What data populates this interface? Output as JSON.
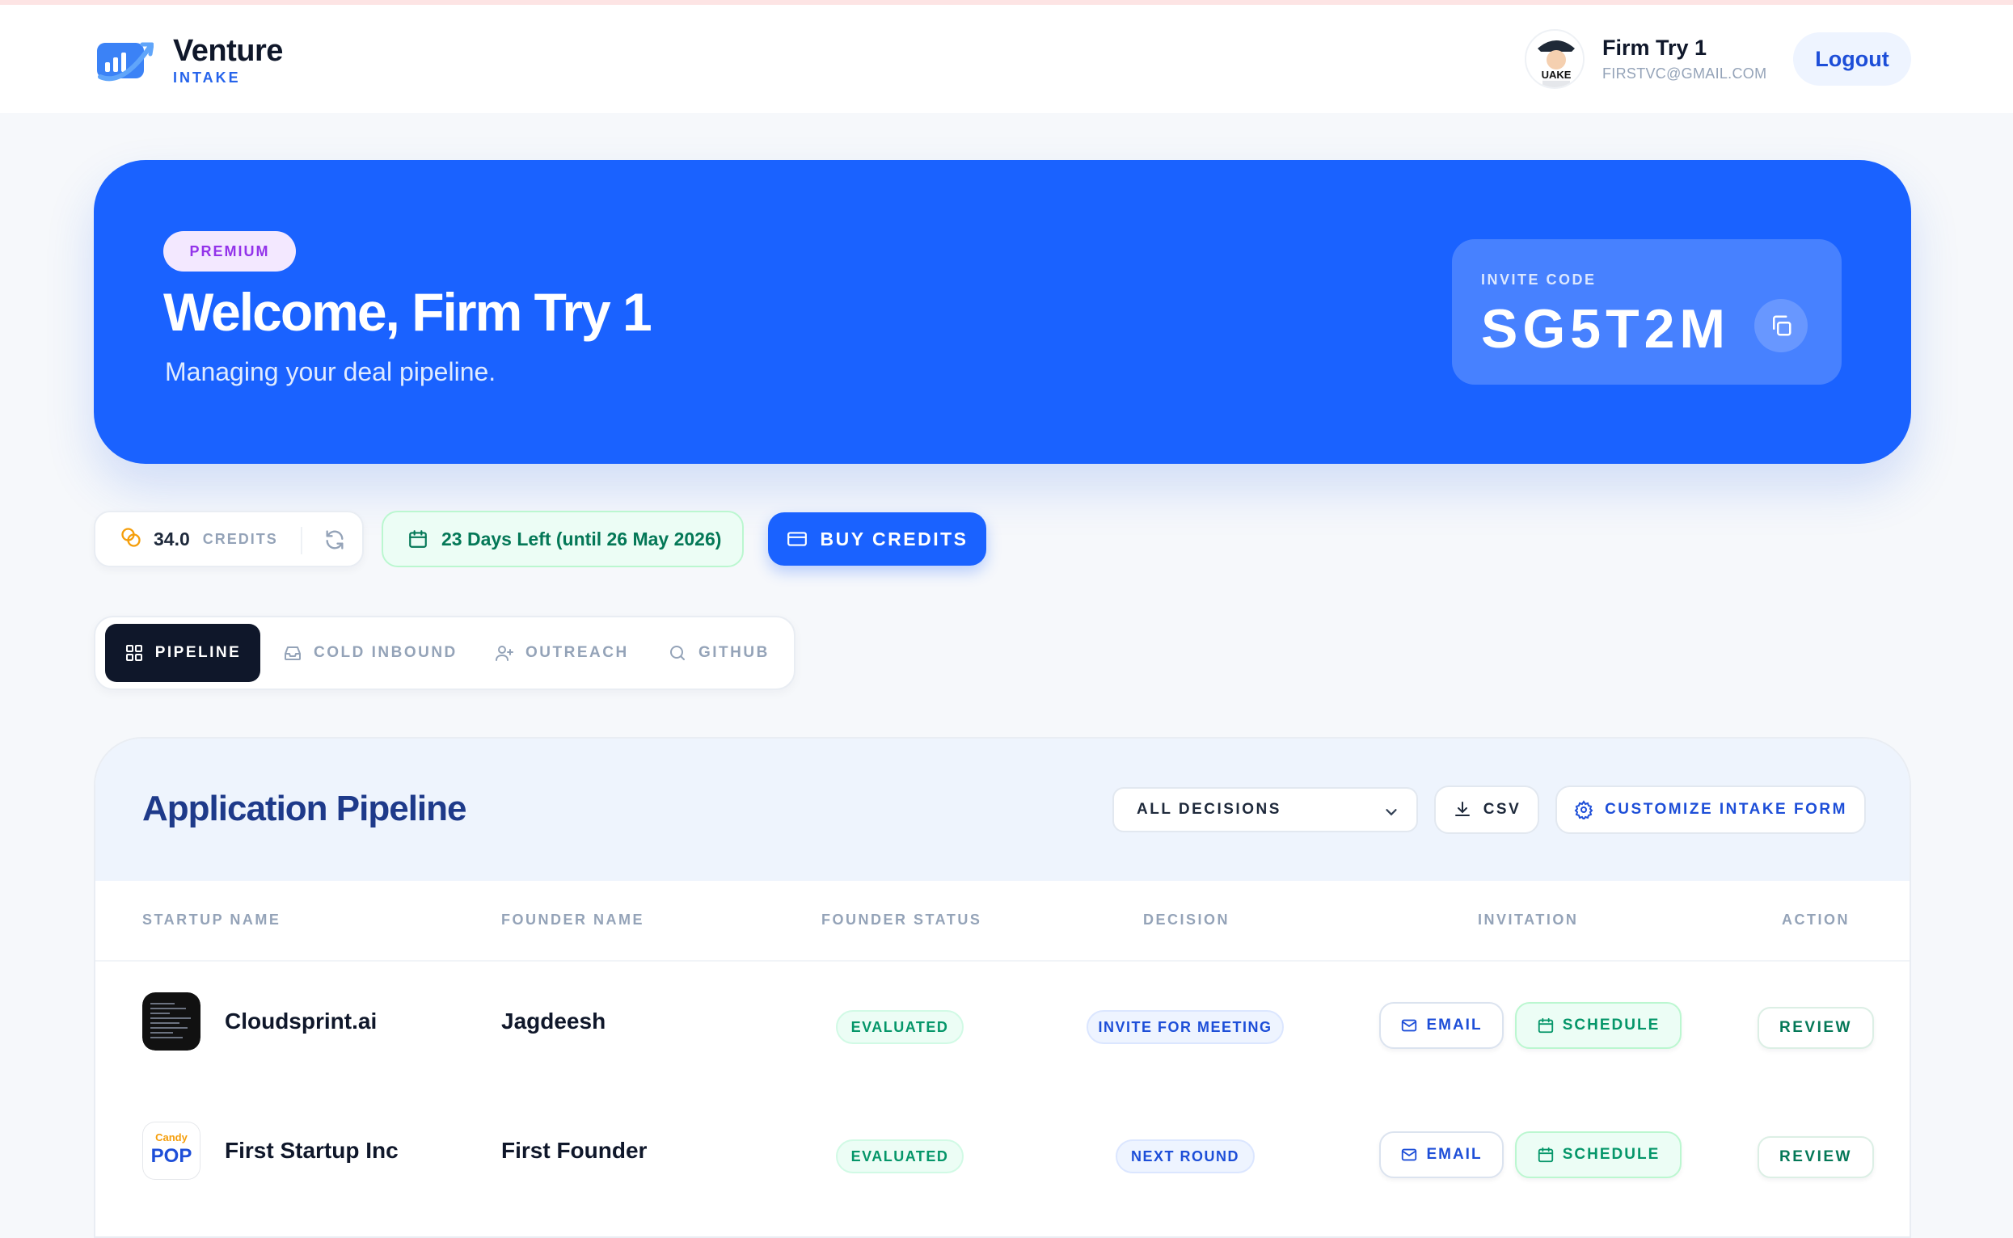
{
  "app": {
    "name": "Venture",
    "subtitle": "INTAKE"
  },
  "user": {
    "name": "Firm Try 1",
    "email": "FIRSTVC@GMAIL.COM",
    "logout_label": "Logout"
  },
  "hero": {
    "badge": "PREMIUM",
    "title": "Welcome, Firm Try 1",
    "subtitle": "Managing your deal pipeline.",
    "invite_label": "INVITE CODE",
    "invite_code": "SG5T2M"
  },
  "stats": {
    "credits_value": "34.0",
    "credits_label": "CREDITS",
    "days_left": "23 Days Left (until 26 May 2026)",
    "buy_label": "BUY CREDITS"
  },
  "tabs": [
    {
      "label": "PIPELINE",
      "icon": "grid-icon",
      "active": true
    },
    {
      "label": "COLD INBOUND",
      "icon": "inbox-icon",
      "active": false
    },
    {
      "label": "OUTREACH",
      "icon": "user-plus-icon",
      "active": false
    },
    {
      "label": "GITHUB",
      "icon": "search-icon",
      "active": false
    }
  ],
  "pipeline": {
    "title": "Application Pipeline",
    "filter_value": "ALL DECISIONS",
    "csv_label": "CSV",
    "customize_label": "CUSTOMIZE INTAKE FORM",
    "columns": [
      "STARTUP NAME",
      "FOUNDER NAME",
      "FOUNDER STATUS",
      "DECISION",
      "INVITATION",
      "ACTION"
    ],
    "rows": [
      {
        "startup": "Cloudsprint.ai",
        "founder": "Jagdeesh",
        "status": "EVALUATED",
        "decision": "INVITE FOR MEETING",
        "email": "EMAIL",
        "schedule": "SCHEDULE",
        "action": "REVIEW"
      },
      {
        "startup": "First Startup Inc",
        "founder": "First Founder",
        "status": "EVALUATED",
        "decision": "NEXT ROUND",
        "email": "EMAIL",
        "schedule": "SCHEDULE",
        "action": "REVIEW"
      }
    ]
  },
  "colors": {
    "primary": "#1a62ff",
    "accent_purple": "#9333ea",
    "success": "#059669",
    "dark": "#0f172a"
  }
}
